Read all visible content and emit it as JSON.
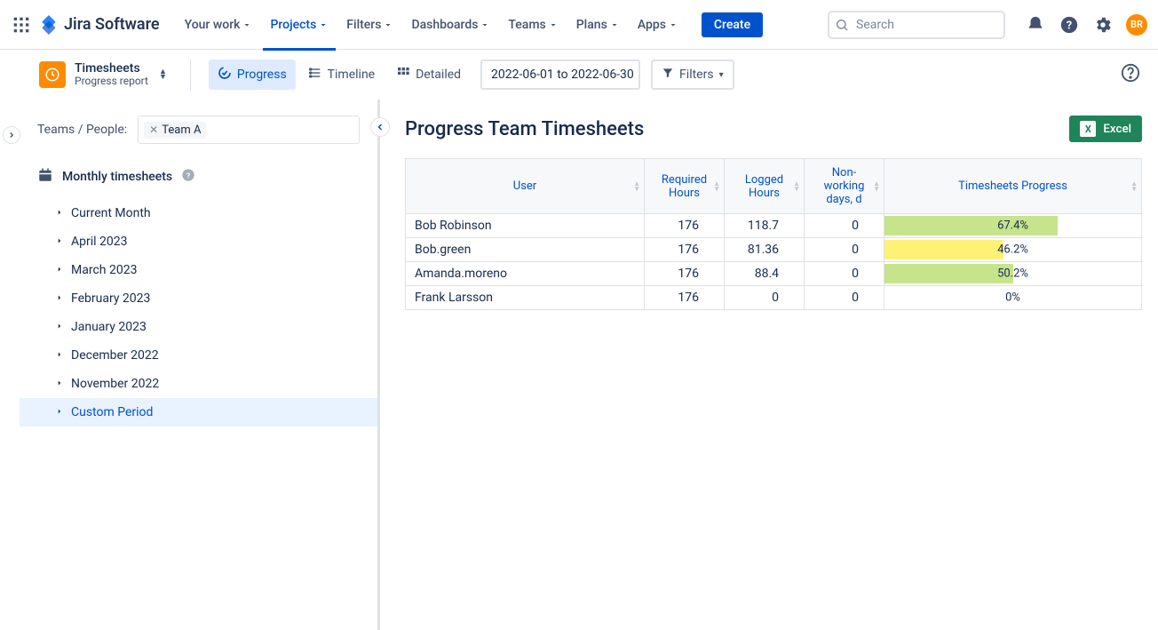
{
  "topnav": {
    "product": "Jira Software",
    "items": [
      {
        "label": "Your work"
      },
      {
        "label": "Projects"
      },
      {
        "label": "Filters"
      },
      {
        "label": "Dashboards"
      },
      {
        "label": "Teams"
      },
      {
        "label": "Plans"
      },
      {
        "label": "Apps"
      }
    ],
    "active_index": 1,
    "create": "Create",
    "search_placeholder": "Search",
    "avatar_initials": "BR"
  },
  "secondary": {
    "project_title": "Timesheets",
    "project_subtitle": "Progress report",
    "views": [
      {
        "label": "Progress"
      },
      {
        "label": "Timeline"
      },
      {
        "label": "Detailed"
      }
    ],
    "active_view": 0,
    "date_range": "2022-06-01 to 2022-06-30",
    "filters_label": "Filters"
  },
  "sidebar": {
    "teams_label": "Teams / People:",
    "selected_team": "Team A",
    "section_title": "Monthly timesheets",
    "items": [
      {
        "label": "Current Month"
      },
      {
        "label": "April 2023"
      },
      {
        "label": "March 2023"
      },
      {
        "label": "February 2023"
      },
      {
        "label": "January 2023"
      },
      {
        "label": "December 2022"
      },
      {
        "label": "November 2022"
      },
      {
        "label": "Custom Period"
      }
    ],
    "active_index": 7
  },
  "content": {
    "title": "Progress Team Timesheets",
    "excel_label": "Excel",
    "columns": [
      "User",
      "Required Hours",
      "Logged Hours",
      "Non-working days, d",
      "Timesheets Progress"
    ],
    "rows": [
      {
        "user": "Bob Robinson",
        "required": "176",
        "logged": "118.7",
        "nonworking": "0",
        "progress": "67.4%",
        "bar_pct": 67.4,
        "bar_color": "#c6e48b"
      },
      {
        "user": "Bob.green",
        "required": "176",
        "logged": "81.36",
        "nonworking": "0",
        "progress": "46.2%",
        "bar_pct": 46.2,
        "bar_color": "#fff176"
      },
      {
        "user": "Amanda.moreno",
        "required": "176",
        "logged": "88.4",
        "nonworking": "0",
        "progress": "50.2%",
        "bar_pct": 50.2,
        "bar_color": "#c6e48b"
      },
      {
        "user": "Frank Larsson",
        "required": "176",
        "logged": "0",
        "nonworking": "0",
        "progress": "0%",
        "bar_pct": 0,
        "bar_color": "transparent"
      }
    ]
  }
}
